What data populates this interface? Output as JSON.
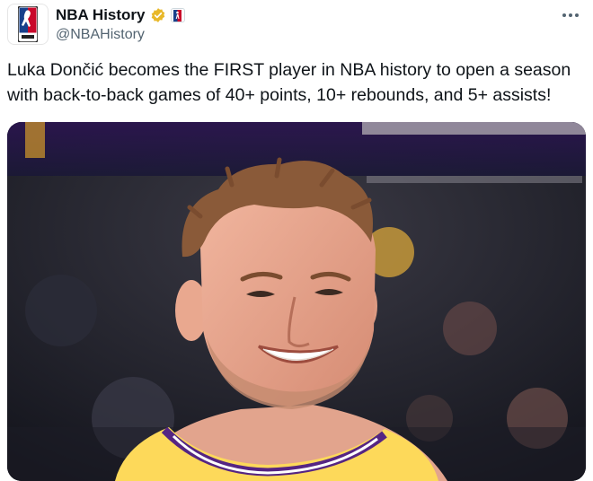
{
  "tweet": {
    "author": {
      "display_name": "NBA History",
      "handle": "@NBAHistory",
      "verified": true,
      "verified_badge_color": "#e8b829",
      "avatar_icon": "nba-logo-icon",
      "affiliate_icon": "nba-logo-icon"
    },
    "more_icon": "more-dots-icon",
    "text": "Luka Dončić becomes the FIRST player in NBA history to open a season with back-to-back games of 40+ points, 10+ rebounds, and 5+ assists!",
    "media": {
      "type": "photo",
      "subject": "smiling basketball player in yellow and purple jersey"
    }
  },
  "colors": {
    "nba_red": "#c9082a",
    "nba_blue": "#17408b",
    "jersey_gold": "#fdd95a",
    "jersey_purple": "#552583"
  }
}
